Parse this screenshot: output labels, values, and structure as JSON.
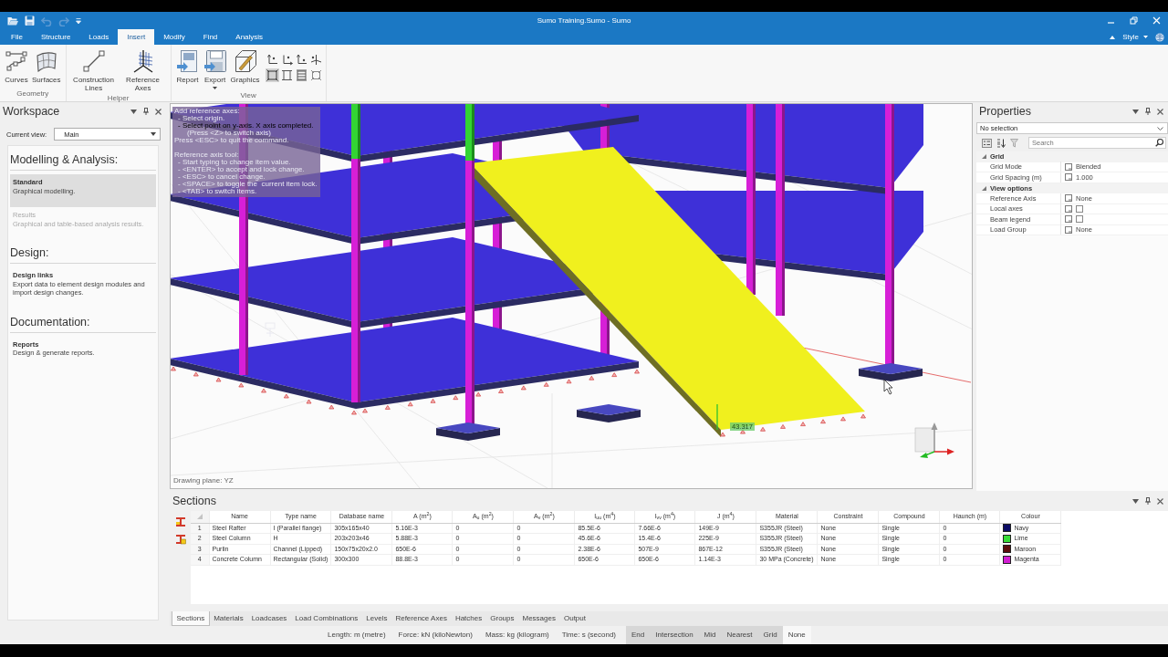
{
  "window": {
    "title": "Sumo Training.Sumo - Sumo"
  },
  "quick_access": [
    {
      "kind": "open",
      "disabled": false
    },
    {
      "kind": "save",
      "disabled": false
    },
    {
      "kind": "undo",
      "disabled": true
    },
    {
      "kind": "redo",
      "disabled": true
    },
    {
      "kind": "customize",
      "disabled": false
    }
  ],
  "ribbon": {
    "tabs": [
      {
        "label": "File",
        "selected": false
      },
      {
        "label": "Structure",
        "selected": false
      },
      {
        "label": "Loads",
        "selected": false
      },
      {
        "label": "Insert",
        "selected": true
      },
      {
        "label": "Modify",
        "selected": false
      },
      {
        "label": "Find",
        "selected": false
      },
      {
        "label": "Analysis",
        "selected": false
      }
    ],
    "style_label": "Style",
    "groups": [
      {
        "label": "Geometry",
        "buttons": [
          {
            "kind": "curves",
            "label": "Curves",
            "dropdown": false
          },
          {
            "kind": "surfaces",
            "label": "Surfaces",
            "dropdown": false
          }
        ]
      },
      {
        "label": "Helper",
        "buttons": [
          {
            "kind": "construction-lines",
            "label": "Construction Lines",
            "dropdown": false
          },
          {
            "kind": "reference-axes",
            "label": "Reference Axes",
            "dropdown": false
          }
        ]
      },
      {
        "label": "View",
        "buttons": [
          {
            "kind": "report",
            "label": "Report",
            "dropdown": false
          },
          {
            "kind": "export",
            "label": "Export",
            "dropdown": true
          },
          {
            "kind": "graphics",
            "label": "Graphics",
            "dropdown": false
          }
        ],
        "view_toggles": [
          {
            "selected": false
          },
          {
            "selected": false
          },
          {
            "selected": false
          },
          {
            "selected": false
          },
          {
            "selected": true
          },
          {
            "selected": false
          },
          {
            "selected": false
          },
          {
            "selected": false
          }
        ]
      }
    ]
  },
  "workspace": {
    "title": "Workspace",
    "current_view": {
      "label": "Current view:",
      "value": "Main"
    },
    "sections": [
      {
        "heading": "Modelling & Analysis:",
        "items": [
          {
            "title": "Standard",
            "description": "Graphical modelling.",
            "selected": true,
            "disabled": false
          },
          {
            "title": "Results",
            "description": "Graphical and table-based analysis results.",
            "selected": false,
            "disabled": true
          }
        ]
      },
      {
        "heading": "Design:",
        "items": [
          {
            "title": "Design links",
            "description": "Export data to element design modules and import design changes.",
            "selected": false,
            "disabled": false
          }
        ]
      },
      {
        "heading": "Documentation:",
        "items": [
          {
            "title": "Reports",
            "description": "Design & generate reports.",
            "selected": false,
            "disabled": false
          }
        ]
      }
    ]
  },
  "viewport": {
    "prompt_groups": [
      {
        "lines": [
          {
            "kind": "title",
            "text": "Add reference axes:",
            "current": false
          },
          {
            "kind": "step",
            "text": "- Select origin.",
            "current": false
          },
          {
            "kind": "step",
            "text": "- Select point on y-axis. X axis completed.",
            "current": true
          },
          {
            "kind": "hint",
            "text": "(Press <Z> to switch axis)",
            "current": false
          },
          {
            "kind": "title",
            "text": "Press <ESC> to quit the command.",
            "current": false
          }
        ]
      },
      {
        "lines": [
          {
            "kind": "title",
            "text": "Reference axis tool:",
            "current": false
          },
          {
            "kind": "step",
            "text": "- Start typing to change item value.",
            "current": false
          },
          {
            "kind": "step",
            "text": "- <ENTER> to accept and lock change.",
            "current": false
          },
          {
            "kind": "step",
            "text": "- <ESC> to cancel change.",
            "current": false
          },
          {
            "kind": "step",
            "text": "- <SPACE> to toggle the  current item lock.",
            "current": false
          },
          {
            "kind": "step",
            "text": "- <TAB> to switch items.",
            "current": false
          }
        ]
      }
    ],
    "dimension_label": "43.317",
    "drawing_plane": "Drawing plane: YZ"
  },
  "properties": {
    "title": "Properties",
    "selection": "No selection",
    "search": {
      "placeholder": "Search"
    },
    "categories": [
      {
        "name": "Grid",
        "expanded": true,
        "rows": [
          {
            "label": "Grid Mode",
            "kind": "text",
            "value": "Blended"
          },
          {
            "label": "Grid Spacing (m)",
            "kind": "text",
            "value": "1.000"
          }
        ]
      },
      {
        "name": "View options",
        "expanded": true,
        "rows": [
          {
            "label": "Reference Axis",
            "kind": "text",
            "value": "None"
          },
          {
            "label": "Local axes",
            "kind": "checkbox",
            "checked": false
          },
          {
            "label": "Beam legend",
            "kind": "checkbox",
            "checked": false
          },
          {
            "label": "Load Group",
            "kind": "text",
            "value": "None"
          }
        ]
      }
    ]
  },
  "sections_panel": {
    "title": "Sections",
    "table": {
      "columns": [
        "Name",
        "Type name",
        "Database name",
        "A (m$^{2}$)",
        "A$_{u}$ (m$^{2}$)",
        "A$_{v}$ (m$^{2}$)",
        "I$_{uu}$ (m$^{4}$)",
        "I$_{vv}$ (m$^{4}$)",
        "J (m$^{4}$)",
        "Material",
        "Constraint",
        "Compound",
        "Haunch (m)",
        "Colour"
      ],
      "rows": [
        {
          "number": "1",
          "cells": [
            "Steel Rafter",
            "I (Parallel flange)",
            "305x165x40",
            "5.16E-3",
            "0",
            "0",
            "85.5E-6",
            "7.66E-6",
            "149E-9",
            "S355JR (Steel)",
            "None",
            "Single",
            "0"
          ],
          "colour": {
            "name": "Navy",
            "color": "#0c0c66"
          }
        },
        {
          "number": "2",
          "cells": [
            "Steel Column",
            "H",
            "203x203x46",
            "5.88E-3",
            "0",
            "0",
            "45.6E-6",
            "15.4E-6",
            "225E-9",
            "S355JR (Steel)",
            "None",
            "Single",
            "0"
          ],
          "colour": {
            "name": "Lime",
            "color": "#38dc38"
          }
        },
        {
          "number": "3",
          "cells": [
            "Purlin",
            "Channel (Lipped)",
            "150x75x20x2.0",
            "650E-6",
            "0",
            "0",
            "2.38E-6",
            "507E-9",
            "867E-12",
            "S355JR (Steel)",
            "None",
            "Single",
            "0"
          ],
          "colour": {
            "name": "Maroon",
            "color": "#5c0e0e"
          }
        },
        {
          "number": "4",
          "cells": [
            "Concrete Column",
            "Rectangular (Solid)",
            "300x300",
            "88.8E-3",
            "0",
            "0",
            "650E-6",
            "650E-6",
            "1.14E-3",
            "30 MPa (Concrete)",
            "None",
            "Single",
            "0"
          ],
          "colour": {
            "name": "Magenta",
            "color": "#d21ed2"
          }
        }
      ]
    },
    "tabs": [
      {
        "label": "Sections",
        "selected": true
      },
      {
        "label": "Materials",
        "selected": false
      },
      {
        "label": "Loadcases",
        "selected": false
      },
      {
        "label": "Load Combinations",
        "selected": false
      },
      {
        "label": "Levels",
        "selected": false
      },
      {
        "label": "Reference Axes",
        "selected": false
      },
      {
        "label": "Hatches",
        "selected": false
      },
      {
        "label": "Groups",
        "selected": false
      },
      {
        "label": "Messages",
        "selected": false
      },
      {
        "label": "Output",
        "selected": false
      }
    ]
  },
  "status_bar": {
    "units": [
      "Length: m (metre)",
      "Force: kN (kiloNewton)",
      "Mass: kg (kilogram)",
      "Time: s (second)"
    ],
    "snaps": [
      {
        "label": "End",
        "on": true
      },
      {
        "label": "Intersection",
        "on": true
      },
      {
        "label": "Mid",
        "on": true
      },
      {
        "label": "Nearest",
        "on": true
      },
      {
        "label": "Grid",
        "on": true
      },
      {
        "label": "None",
        "on": false
      }
    ]
  }
}
